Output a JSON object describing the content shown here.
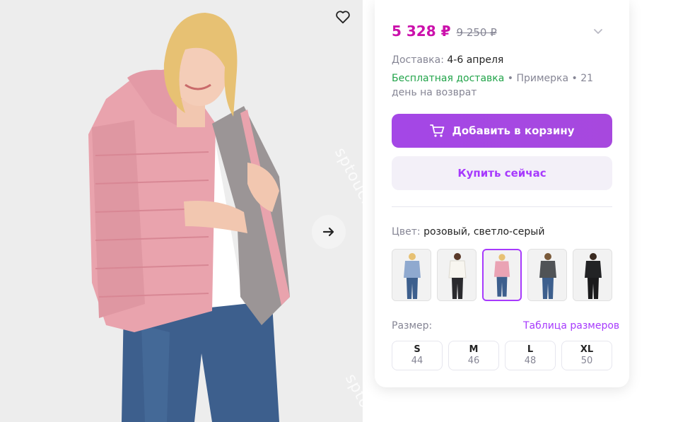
{
  "product": {
    "price_current": "5 328 ₽",
    "price_old": "9 250 ₽",
    "delivery_label": "Доставка:",
    "delivery_value": "4-6 апреля",
    "free_delivery": "Бесплатная доставка",
    "perks_rest": " • Примерка • 21 день на возврат",
    "add_to_cart": "Добавить в корзину",
    "buy_now": "Купить сейчас",
    "color_label": "Цвет:",
    "color_value": "розовый, светло-серый",
    "size_label": "Размер:",
    "size_table": "Таблица размеров",
    "sizes": [
      {
        "label": "S",
        "num": "44"
      },
      {
        "label": "M",
        "num": "46"
      },
      {
        "label": "L",
        "num": "48"
      },
      {
        "label": "XL",
        "num": "50"
      }
    ],
    "variants": [
      {
        "color": "#8fa9cf",
        "name": "blue"
      },
      {
        "color": "#f1efe9",
        "name": "cream"
      },
      {
        "color": "#eaa3b4",
        "name": "pink"
      },
      {
        "color": "#505356",
        "name": "grey"
      },
      {
        "color": "#222325",
        "name": "black"
      }
    ]
  },
  "watermark": "sptouch",
  "icons": {
    "favorite": "heart-icon",
    "next": "arrow-right-icon",
    "cart": "cart-icon",
    "expand": "chevron-down-icon"
  },
  "colors": {
    "accent": "#a73afd",
    "price": "#cb11ab",
    "free": "#22a44a"
  }
}
